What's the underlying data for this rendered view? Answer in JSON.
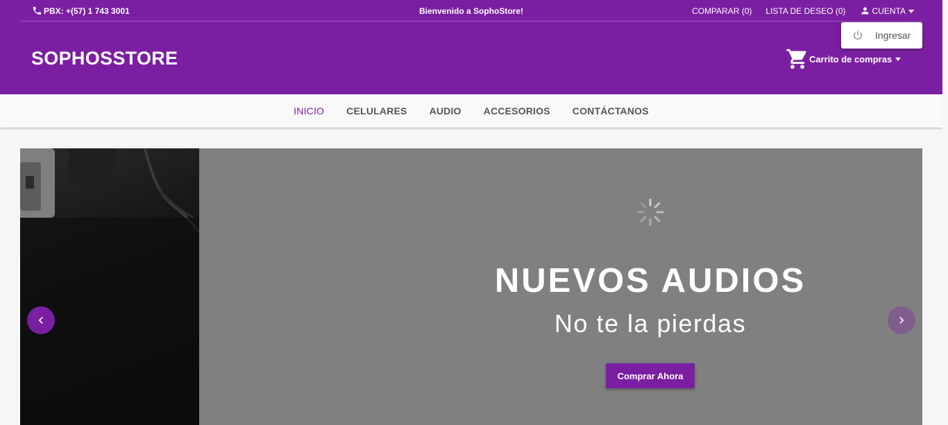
{
  "topbar": {
    "phone": "PBX: +(57) 1 743 3001",
    "welcome": "Bienvenido a SophoStore!",
    "compare": "COMPARAR (0)",
    "wishlist": "LISTA DE DESEO (0)",
    "account": "CUENTA"
  },
  "account_menu": {
    "login": "Ingresar"
  },
  "header": {
    "brand": "SOPHOSSTORE",
    "cart": "Carrito de compras"
  },
  "nav": {
    "items": [
      {
        "label": "INICIO",
        "active": true
      },
      {
        "label": "CELULARES",
        "active": false
      },
      {
        "label": "AUDIO",
        "active": false
      },
      {
        "label": "ACCESORIOS",
        "active": false
      },
      {
        "label": "CONTÁCTANOS",
        "active": false
      }
    ]
  },
  "slider": {
    "title": "NUEVOS AUDIOS",
    "subtitle": "No te la pierdas",
    "cta": "Comprar Ahora"
  },
  "icons": [
    "phone-icon",
    "person-icon",
    "caret-down-icon",
    "cart-icon",
    "power-icon",
    "chevron-left-icon",
    "chevron-right-icon",
    "loading-spinner-icon"
  ],
  "colors": {
    "brand": "#7b1fa2",
    "slider_bg": "#808080",
    "nav_bg": "#f9f9f9"
  }
}
